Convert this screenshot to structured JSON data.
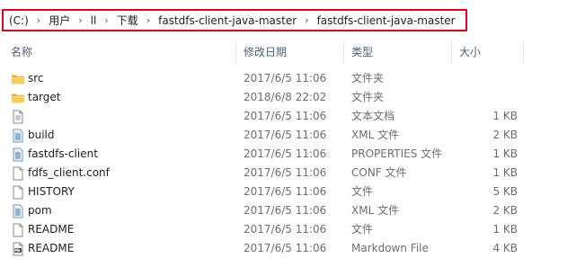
{
  "breadcrumb": {
    "drive": "(C:)",
    "parts": [
      "用户",
      "ll",
      "下载",
      "fastdfs-client-java-master",
      "fastdfs-client-java-master"
    ]
  },
  "columns": {
    "name": "名称",
    "date": "修改日期",
    "type": "类型",
    "size": "大小"
  },
  "files": [
    {
      "name": "src",
      "date": "2017/6/5 11:06",
      "type": "文件夹",
      "size": "",
      "icon": "folder-icon"
    },
    {
      "name": "target",
      "date": "2018/6/8 22:02",
      "type": "文件夹",
      "size": "",
      "icon": "folder-icon"
    },
    {
      "name": "",
      "date": "2017/6/5 11:06",
      "type": "文本文档",
      "size": "1 KB",
      "icon": "text-file-icon"
    },
    {
      "name": "build",
      "date": "2017/6/5 11:06",
      "type": "XML 文件",
      "size": "2 KB",
      "icon": "xml-file-icon"
    },
    {
      "name": "fastdfs-client",
      "date": "2017/6/5 11:06",
      "type": "PROPERTIES 文件",
      "size": "1 KB",
      "icon": "properties-file-icon"
    },
    {
      "name": "fdfs_client.conf",
      "date": "2017/6/5 11:06",
      "type": "CONF 文件",
      "size": "1 KB",
      "icon": "blank-file-icon"
    },
    {
      "name": "HISTORY",
      "date": "2017/6/5 11:06",
      "type": "文件",
      "size": "5 KB",
      "icon": "blank-file-icon"
    },
    {
      "name": "pom",
      "date": "2017/6/5 11:06",
      "type": "XML 文件",
      "size": "2 KB",
      "icon": "xml-file-icon"
    },
    {
      "name": "README",
      "date": "2017/6/5 11:06",
      "type": "文件",
      "size": "1 KB",
      "icon": "blank-file-icon"
    },
    {
      "name": "README",
      "date": "2017/6/5 11:06",
      "type": "Markdown File",
      "size": "4 KB",
      "icon": "markdown-file-icon"
    }
  ]
}
